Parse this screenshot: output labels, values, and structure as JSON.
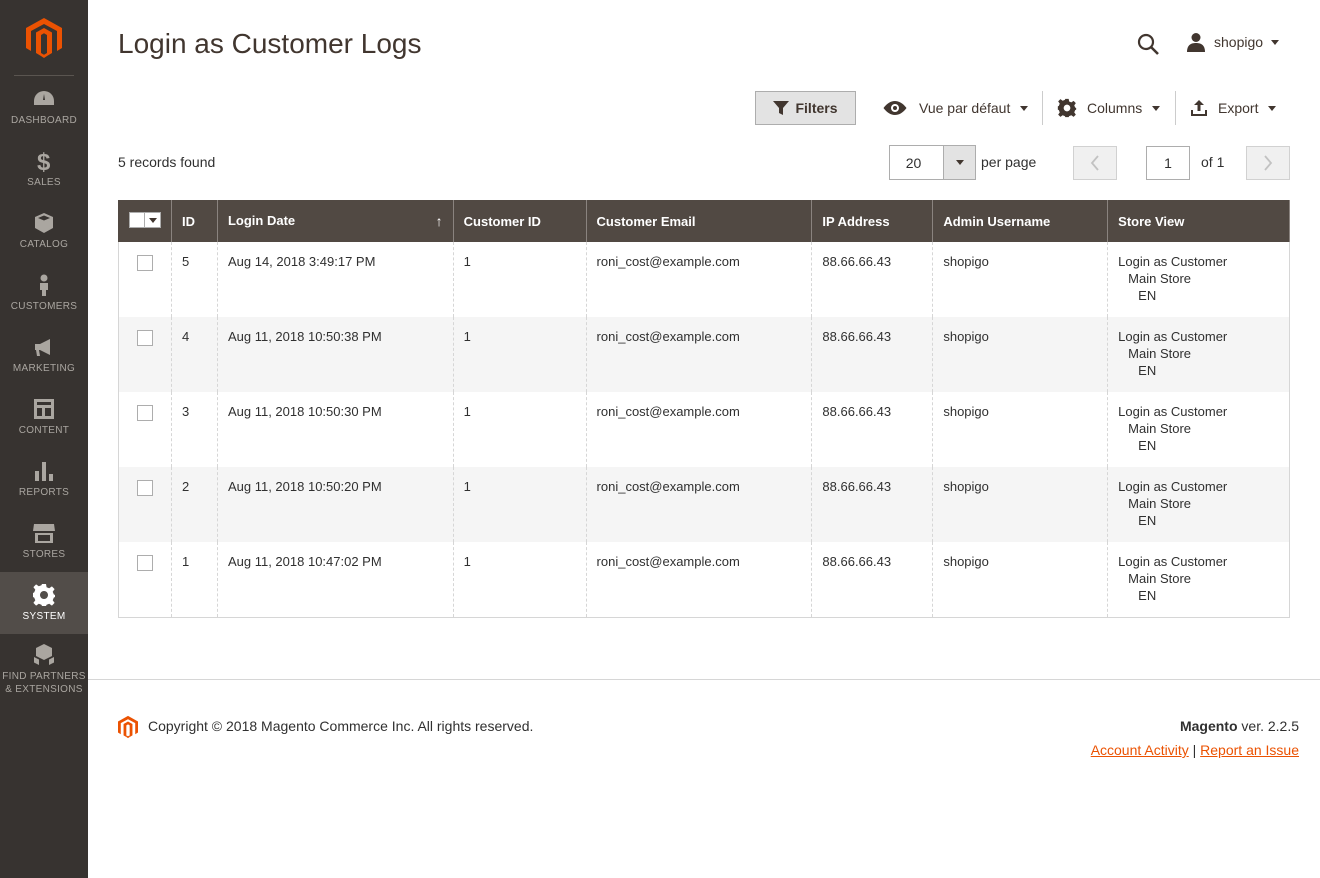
{
  "sidebar": {
    "logo_icon": "magento-logo-icon",
    "items": [
      {
        "label": "DASHBOARD",
        "icon": "dashboard-icon"
      },
      {
        "label": "SALES",
        "icon": "dollar-icon"
      },
      {
        "label": "CATALOG",
        "icon": "box-icon"
      },
      {
        "label": "CUSTOMERS",
        "icon": "person-icon"
      },
      {
        "label": "MARKETING",
        "icon": "megaphone-icon"
      },
      {
        "label": "CONTENT",
        "icon": "layout-icon"
      },
      {
        "label": "REPORTS",
        "icon": "bar-chart-icon"
      },
      {
        "label": "STORES",
        "icon": "storefront-icon"
      },
      {
        "label": "SYSTEM",
        "icon": "gear-icon",
        "active": true
      },
      {
        "label": "FIND PARTNERS & EXTENSIONS",
        "icon": "boxes-icon"
      }
    ]
  },
  "header": {
    "title": "Login as Customer Logs",
    "user": "shopigo"
  },
  "toolbar": {
    "filters": "Filters",
    "view": "Vue par défaut",
    "columns": "Columns",
    "export": "Export"
  },
  "grid_info": {
    "records": "5 records found",
    "per_page_value": "20",
    "per_page_label": "per page",
    "current_page": "1",
    "page_of": "of 1"
  },
  "table": {
    "headers": [
      "ID",
      "Login Date",
      "Customer ID",
      "Customer Email",
      "IP Address",
      "Admin Username",
      "Store View"
    ],
    "sort_indicator": "↑",
    "rows": [
      {
        "id": "5",
        "date": "Aug 14, 2018 3:49:17 PM",
        "customer_id": "1",
        "email": "roni_cost@example.com",
        "ip": "88.66.66.43",
        "admin": "shopigo",
        "store1": "Login as Customer",
        "store2": "Main Store",
        "store3": "EN"
      },
      {
        "id": "4",
        "date": "Aug 11, 2018 10:50:38 PM",
        "customer_id": "1",
        "email": "roni_cost@example.com",
        "ip": "88.66.66.43",
        "admin": "shopigo",
        "store1": "Login as Customer",
        "store2": "Main Store",
        "store3": "EN"
      },
      {
        "id": "3",
        "date": "Aug 11, 2018 10:50:30 PM",
        "customer_id": "1",
        "email": "roni_cost@example.com",
        "ip": "88.66.66.43",
        "admin": "shopigo",
        "store1": "Login as Customer",
        "store2": "Main Store",
        "store3": "EN"
      },
      {
        "id": "2",
        "date": "Aug 11, 2018 10:50:20 PM",
        "customer_id": "1",
        "email": "roni_cost@example.com",
        "ip": "88.66.66.43",
        "admin": "shopigo",
        "store1": "Login as Customer",
        "store2": "Main Store",
        "store3": "EN"
      },
      {
        "id": "1",
        "date": "Aug 11, 2018 10:47:02 PM",
        "customer_id": "1",
        "email": "roni_cost@example.com",
        "ip": "88.66.66.43",
        "admin": "shopigo",
        "store1": "Login as Customer",
        "store2": "Main Store",
        "store3": "EN"
      }
    ]
  },
  "footer": {
    "copyright": "Copyright © 2018 Magento Commerce Inc. All rights reserved.",
    "brand": "Magento",
    "version": " ver. 2.2.5",
    "account_activity": "Account Activity",
    "separator": "|",
    "report_issue": "Report an Issue"
  },
  "colors": {
    "sidebar_bg": "#373330",
    "accent": "#eb5202",
    "table_header_bg": "#514943"
  }
}
